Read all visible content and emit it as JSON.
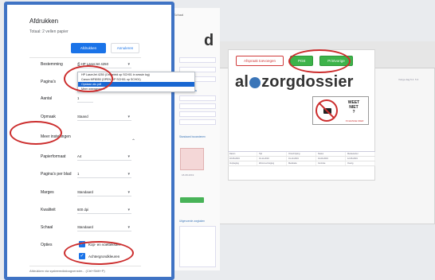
{
  "background_app": {
    "preview_label": "Schaal",
    "toolbar": {
      "afspraak_label": "Afspraak toevoegen",
      "print_label": "Print",
      "previous_label": "Printvorige"
    },
    "brand_prefix": "al",
    "brand_suffix": "zorgdossier",
    "big_letter": "d",
    "weet_niet_line1": "WEET",
    "weet_niet_line2": "NIET",
    "weet_niet_line3": "?",
    "weet_niet_sub": "XCHANGE DIER",
    "left_section_1": "Cliëntgegevens",
    "left_section_2": "Standaard bouwstenen",
    "left_section_3": "Uitgevoerde zorgtaken",
    "left_date": "18-08-2019",
    "right_side_text": "Vorige dag 5.4. 5.3",
    "table_cells": [
      [
        "Datum",
        "Tijd",
        "Omschrijving",
        "Status",
        "Medewerker"
      ],
      [
        "18-08-2019",
        "01-11-2019",
        "01-10-2019",
        "01-09-2019",
        "12-08-2019"
      ],
      [
        "Verpleging",
        "Wond-verzorging",
        "Medicatie",
        "Controle",
        "Overig"
      ]
    ],
    "colors": {
      "green": "#3db34a",
      "red": "#d13b3b",
      "dialog_border": "#3f73c4",
      "accent_blue": "#1a73e8"
    }
  },
  "dialog": {
    "title": "Afdrukken",
    "subtitle": "Totaal: 2 vellen papier",
    "tabs": [
      {
        "label": "Afdrukken",
        "active": true
      },
      {
        "label": "Annuleren",
        "active": false
      }
    ],
    "bestemming_label": "Bestemming",
    "bestemming_value": "HP LaserJet 4250",
    "dropdown_options": [
      "HP LaserJet 4250 (Omgeleid op SCH01 in sessie log)",
      "Canon MF8050 (OPEN OP SCH01 op SCH01)",
      "Opslaan als pdf",
      "Meer weergeven..."
    ],
    "dropdown_selected_index": 2,
    "rows": [
      {
        "label": "Pagina's",
        "value": "Alles"
      },
      {
        "label": "Aantal",
        "value": "1"
      },
      {
        "label": "Opmaak",
        "value": "Staand"
      },
      {
        "label": "Meer instellingen",
        "value": ""
      },
      {
        "label": "Papierformaat",
        "value": "A4"
      },
      {
        "label": "Pagina's per blad",
        "value": "1"
      },
      {
        "label": "Marges",
        "value": "Standaard"
      },
      {
        "label": "Kwaliteit",
        "value": "600 dpi"
      },
      {
        "label": "Schaal",
        "value": "Standaard"
      },
      {
        "label": "Opties",
        "value": ""
      }
    ],
    "option_headers_footers": "Kop- en voetteksten",
    "option_background": "Achtergrondkleuren",
    "footer_text": "Afdrukken via systeemdialoogvenster... (Ctrl+Shift+P)"
  }
}
